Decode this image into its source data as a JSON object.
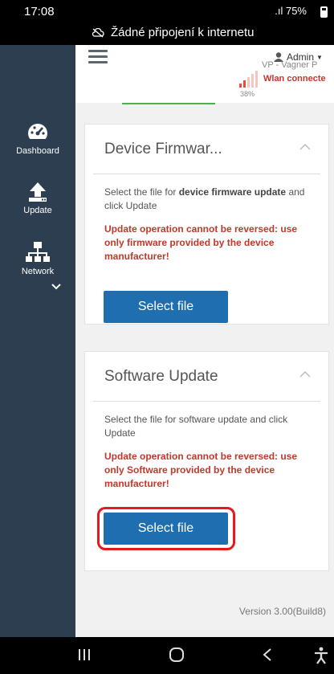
{
  "status_bar": {
    "time": "17:08",
    "signal": ".ıl 75%",
    "network_note": "Žádné připojení k internetu"
  },
  "topbar": {
    "user": "Admin",
    "device_name": "VP - Vagner P",
    "wlan_status": "Wlan connecte",
    "signal_percent": "38%"
  },
  "sidebar": {
    "items": [
      {
        "label": "Dashboard",
        "icon": "dashboard-icon"
      },
      {
        "label": "Update",
        "icon": "upload-icon"
      },
      {
        "label": "Network",
        "icon": "network-icon"
      }
    ]
  },
  "cards": [
    {
      "title": "Device Firmwar...",
      "desc_pre": "Select the file for ",
      "desc_bold": "device firmware update",
      "desc_post": " and click Update",
      "warning": "Update operation cannot be reversed: use only firmware provided by the device manufacturer!",
      "button": "Select file"
    },
    {
      "title": "Software Update",
      "desc": "Select the file for software update and click Update",
      "warning": "Update operation cannot be reversed: use only Software provided by the device manufacturer!",
      "button": "Select file"
    }
  ],
  "footer": {
    "version": "Version 3.00(Build8)"
  },
  "colors": {
    "sidebar_bg": "#2d3e50",
    "button_bg": "#1f6fb0",
    "warning_text": "#c0392b",
    "highlight_border": "#e3191c"
  }
}
